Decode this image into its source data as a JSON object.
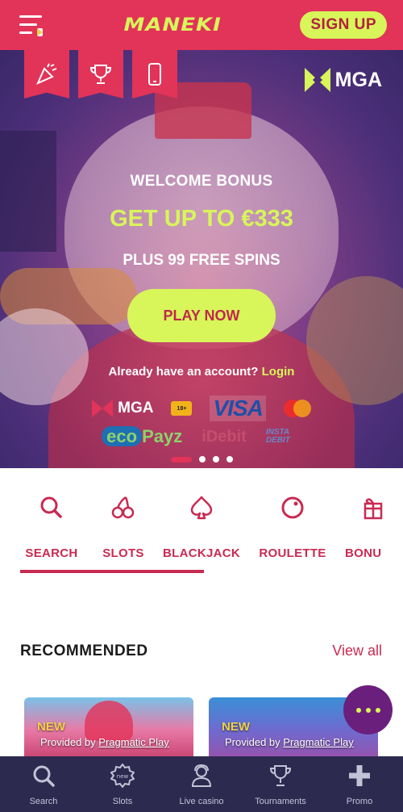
{
  "header": {
    "logo": "maneki",
    "signup_label": "SIGN UP"
  },
  "hero": {
    "flag_icons": [
      "party-popper-icon",
      "trophy-icon",
      "mobile-phone-icon"
    ],
    "mga_label": "MGA",
    "welcome": "WELCOME BONUS",
    "bonus": "GET UP TO €333",
    "spins": "PLUS 99 FREE SPINS",
    "play_label": "PLAY NOW",
    "account_text": "Already have an account?",
    "login_label": "Login",
    "payments": {
      "mga": "MGA",
      "age": "18+",
      "visa": "VISA",
      "ecopayz_eco": "eco",
      "ecopayz_payz": "Payz",
      "idebit": "iDebit",
      "insta_debit": "INSTA DEBIT"
    },
    "slides": 4,
    "active_slide": 1
  },
  "categories": [
    {
      "label": "SEARCH",
      "icon": "search-icon"
    },
    {
      "label": "SLOTS",
      "icon": "cherries-icon"
    },
    {
      "label": "BLACKJACK",
      "icon": "spade-icon"
    },
    {
      "label": "ROULETTE",
      "icon": "roulette-icon"
    },
    {
      "label": "BONU",
      "icon": "gift-icon"
    }
  ],
  "recommended": {
    "title": "RECOMMENDED",
    "view_all": "View all",
    "games": [
      {
        "badge": "NEW",
        "provided_by": "Provided by",
        "provider": "Pragmatic Play"
      },
      {
        "badge": "NEW",
        "provided_by": "Provided by",
        "provider": "Pragmatic Play"
      }
    ]
  },
  "bottom_nav": [
    {
      "label": "Search",
      "icon": "search-icon"
    },
    {
      "label": "Slots",
      "icon": "new-badge-icon"
    },
    {
      "label": "Live casino",
      "icon": "dealer-icon"
    },
    {
      "label": "Tournaments",
      "icon": "trophy-icon"
    },
    {
      "label": "Promo",
      "icon": "plus-icon"
    }
  ],
  "colors": {
    "brand": "#e23359",
    "accent": "#d8f55a",
    "nav_bg": "#2d2a50",
    "text_red": "#c92a51"
  }
}
